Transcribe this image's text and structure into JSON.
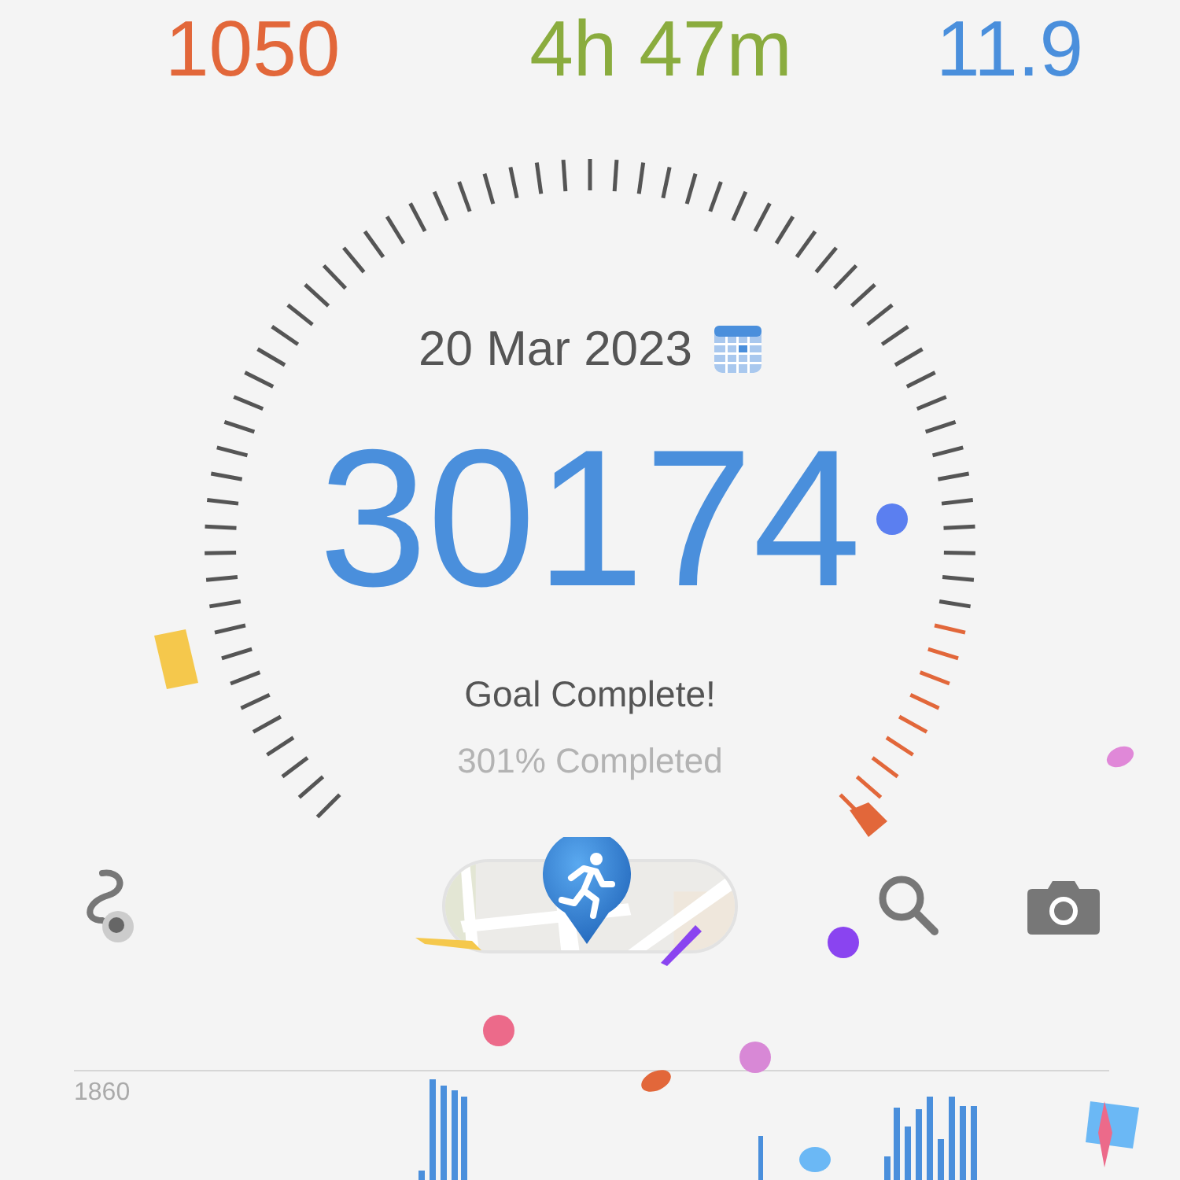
{
  "stats": [
    {
      "value": "1050",
      "color": "#e2673a"
    },
    {
      "value": "4h 47m",
      "color": "#8aac3e"
    },
    {
      "value": "11.9",
      "color": "#4a8fdc"
    }
  ],
  "date": "20 Mar 2023",
  "steps": "30174",
  "goal_status": "Goal Complete!",
  "percent": "301% Completed",
  "chart": {
    "max_label": "1860"
  }
}
